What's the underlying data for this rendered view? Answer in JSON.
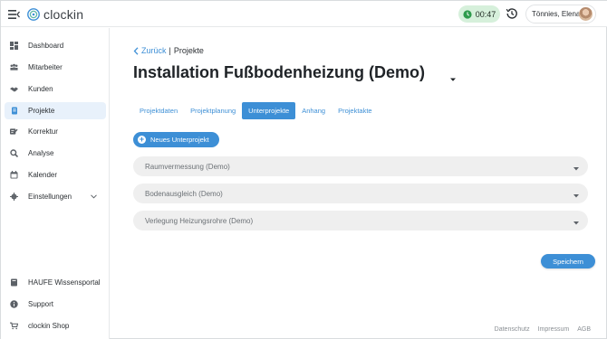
{
  "header": {
    "logo_text": "clockin",
    "timer": "00:47",
    "user_name": "Tönnies, Elena"
  },
  "sidebar": {
    "items": [
      {
        "label": "Dashboard",
        "icon": "dashboard-icon"
      },
      {
        "label": "Mitarbeiter",
        "icon": "employees-icon"
      },
      {
        "label": "Kunden",
        "icon": "handshake-icon"
      },
      {
        "label": "Projekte",
        "icon": "project-icon",
        "active": true
      },
      {
        "label": "Korrektur",
        "icon": "correction-icon"
      },
      {
        "label": "Analyse",
        "icon": "analysis-icon"
      },
      {
        "label": "Kalender",
        "icon": "calendar-icon"
      },
      {
        "label": "Einstellungen",
        "icon": "gear-icon"
      }
    ],
    "bottom_items": [
      {
        "label": "HAUFE Wissensportal",
        "icon": "book-icon"
      },
      {
        "label": "Support",
        "icon": "info-icon"
      },
      {
        "label": "clockin Shop",
        "icon": "cart-icon"
      }
    ]
  },
  "breadcrumb": {
    "back": "Zurück",
    "separator": "|",
    "current": "Projekte"
  },
  "page_title": "Installation Fußbodenheizung (Demo)",
  "tabs": [
    {
      "label": "Projektdaten"
    },
    {
      "label": "Projektplanung"
    },
    {
      "label": "Unterprojekte",
      "active": true
    },
    {
      "label": "Anhang"
    },
    {
      "label": "Projektakte"
    }
  ],
  "new_subproject_label": "Neues Unterprojekt",
  "subprojects": [
    {
      "label": "Raumvermessung (Demo)"
    },
    {
      "label": "Bodenausgleich (Demo)"
    },
    {
      "label": "Verlegung Heizungsrohre (Demo)"
    }
  ],
  "save_label": "Speichern",
  "footer": {
    "privacy": "Datenschutz",
    "imprint": "Impressum",
    "terms": "AGB"
  },
  "colors": {
    "accent": "#3d8fd6",
    "timer_bg": "#d6f0db",
    "active_nav_bg": "#e8f1fb",
    "select_bg": "#efefef"
  }
}
